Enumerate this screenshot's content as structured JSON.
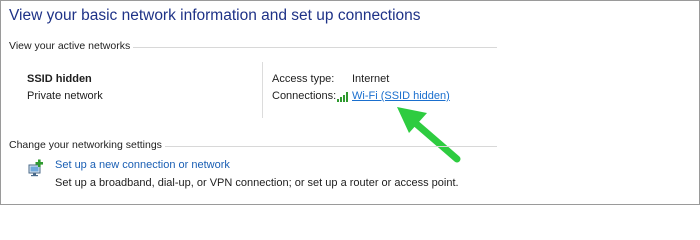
{
  "page": {
    "title": "View your basic network information and set up connections"
  },
  "active_networks": {
    "heading": "View your active networks",
    "network_name": "SSID hidden",
    "network_type": "Private network",
    "access_type_label": "Access type:",
    "access_type_value": "Internet",
    "connections_label": "Connections:",
    "connection_link": "Wi-Fi (SSID hidden)",
    "connection_icon": "wifi-signal-icon"
  },
  "settings": {
    "heading": "Change your networking settings",
    "setup_link": "Set up a new connection or network",
    "setup_description": "Set up a broadband, dial-up, or VPN connection; or set up a router or access point.",
    "setup_icon": "network-setup-icon"
  },
  "annotation": {
    "arrow_color": "#2ecc40"
  }
}
